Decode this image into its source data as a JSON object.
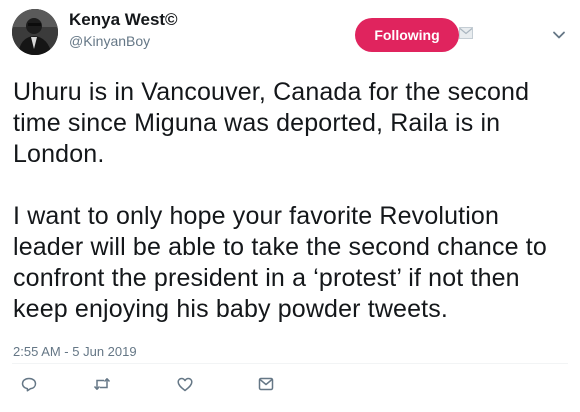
{
  "user": {
    "display_name": "Kenya West©",
    "handle": "@KinyanBoy",
    "avatar_icon": "avatar-photo"
  },
  "header": {
    "follow_label": "Following",
    "follow_color": "#e0245e",
    "dm_icon": "envelope-icon",
    "menu_icon": "chevron-down-icon"
  },
  "tweet": {
    "paragraphs": [
      "Uhuru is in Vancouver, Canada for the second time since Miguna was deported, Raila is in London.",
      "I want to only hope your favorite Revolution leader will be able to take the second chance to confront the president in a ‘protest’ if not then keep enjoying his baby powder tweets."
    ],
    "timestamp": "2:55 AM - 5 Jun 2019"
  },
  "actions": {
    "reply_icon": "reply-icon",
    "retweet_icon": "retweet-icon",
    "like_icon": "heart-icon",
    "message_icon": "direct-message-icon",
    "icon_color": "#657786"
  }
}
